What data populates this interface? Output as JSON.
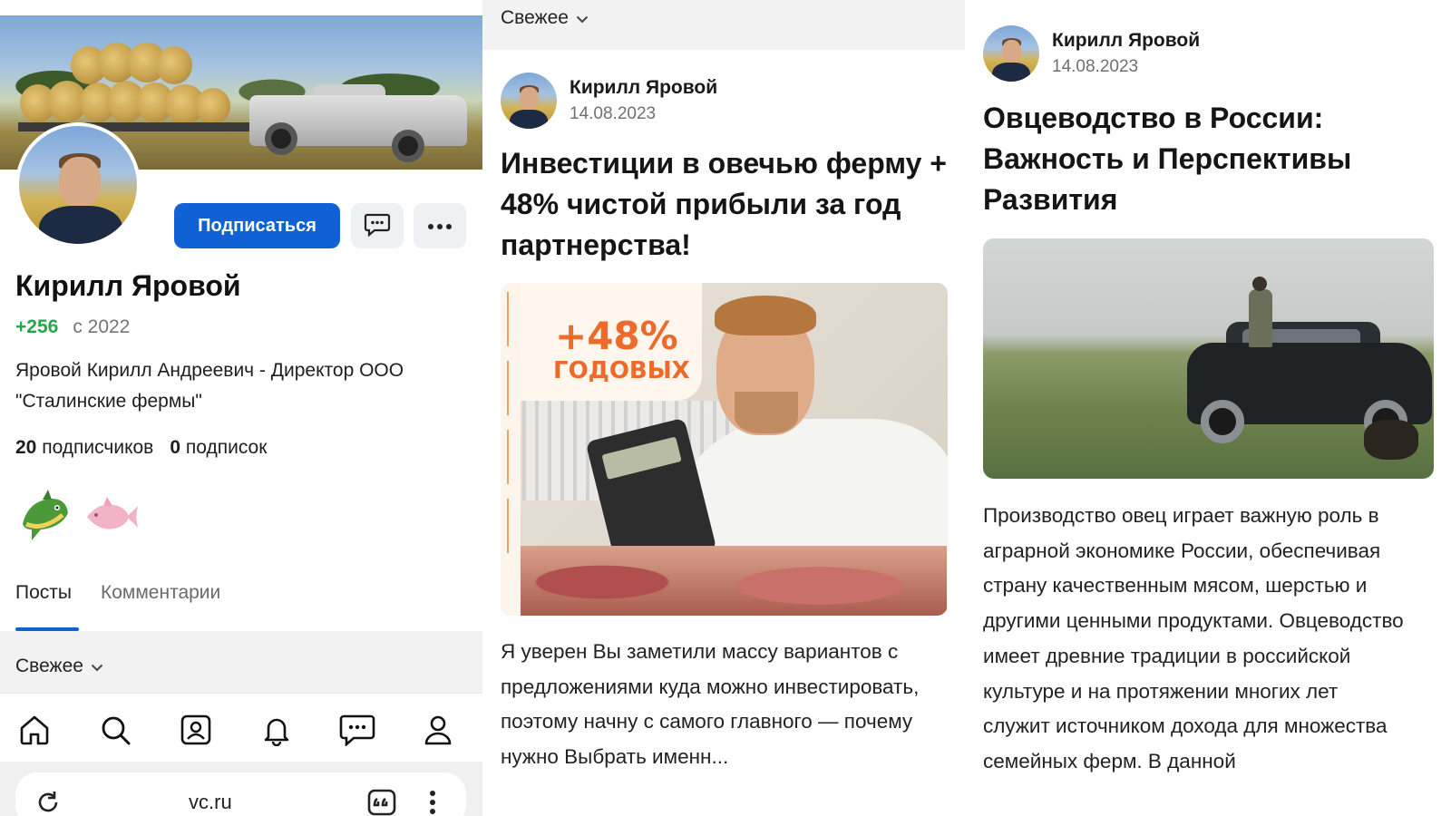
{
  "profile": {
    "name": "Кирилл Яровой",
    "rating": "+256",
    "since": "с 2022",
    "bio": "Яровой Кирилл Андреевич - Директор ООО \"Сталинские фермы\"",
    "followers_count": "20",
    "followers_label": "подписчиков",
    "following_count": "0",
    "following_label": "подписок",
    "subscribe_label": "Подписаться",
    "accent_color": "#1062d4",
    "rating_color": "#26a84a"
  },
  "tabs": [
    {
      "label": "Посты",
      "active": true
    },
    {
      "label": "Комментарии",
      "active": false
    }
  ],
  "sort": {
    "label": "Свежее"
  },
  "bottom_nav": [
    "home-icon",
    "search-icon",
    "profile-card-icon",
    "bell-icon",
    "messages-icon",
    "user-icon"
  ],
  "browser": {
    "url": "vc.ru"
  },
  "post1": {
    "author": "Кирилл Яровой",
    "date": "14.08.2023",
    "title": "Инвестиции в овечью ферму + 48% чистой прибыли за год партнерства!",
    "image_badge_percent": "+48%",
    "image_badge_word": "ГОДОВЫХ",
    "excerpt": "Я уверен Вы заметили массу вариантов с предложениями куда можно инвестировать, поэтому начну с самого главного — почему нужно Выбрать именн..."
  },
  "post2": {
    "author": "Кирилл Яровой",
    "date": "14.08.2023",
    "title": "Овцеводство в России: Важность и Перспективы Развития",
    "text": "Производство овец играет важную роль в аграрной экономике России, обеспечивая страну качественным мясом, шерстью и другими ценными продуктами. Овцеводство имеет древние традиции в российской культуре и на протяжении многих лет служит источником дохода для множества семейных ферм. В данной"
  }
}
